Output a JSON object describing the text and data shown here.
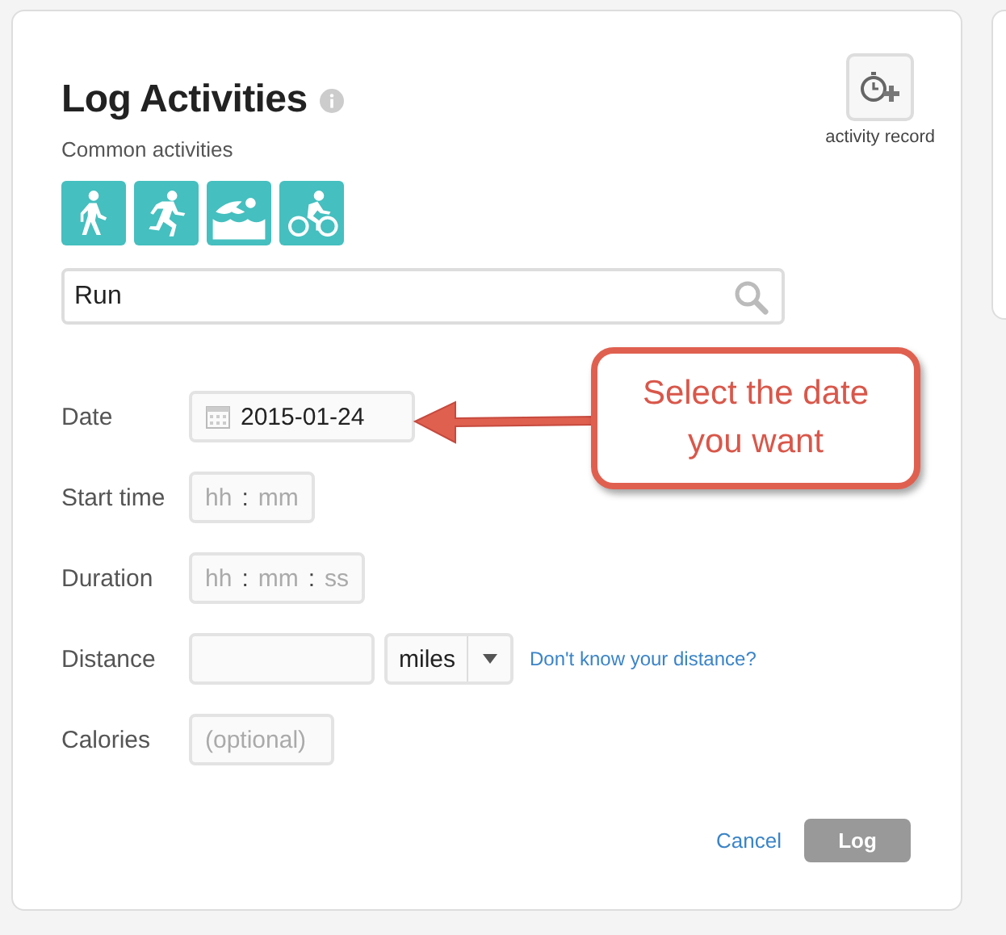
{
  "title": "Log Activities",
  "record_button": {
    "label": "activity record"
  },
  "common_activities": {
    "label": "Common activities",
    "items": [
      {
        "kind": "walk"
      },
      {
        "kind": "run"
      },
      {
        "kind": "swim"
      },
      {
        "kind": "bike"
      }
    ]
  },
  "search": {
    "value": "Run"
  },
  "fields": [
    {
      "kind": "date",
      "label": "Date",
      "value": "2015-01-24"
    },
    {
      "kind": "time",
      "label": "Start time",
      "parts": [
        "hh",
        ":",
        "mm"
      ]
    },
    {
      "kind": "time",
      "label": "Duration",
      "parts": [
        "hh",
        ":",
        "mm",
        ":",
        "ss"
      ]
    },
    {
      "kind": "distance",
      "label": "Distance",
      "unit": "miles",
      "link": "Don't know your distance?"
    },
    {
      "kind": "text",
      "label": "Calories",
      "placeholder": "(optional)"
    }
  ],
  "actions": {
    "cancel": "Cancel",
    "submit": "Log",
    "submit_disabled": true
  },
  "callout": {
    "text": "Select the date you want"
  }
}
